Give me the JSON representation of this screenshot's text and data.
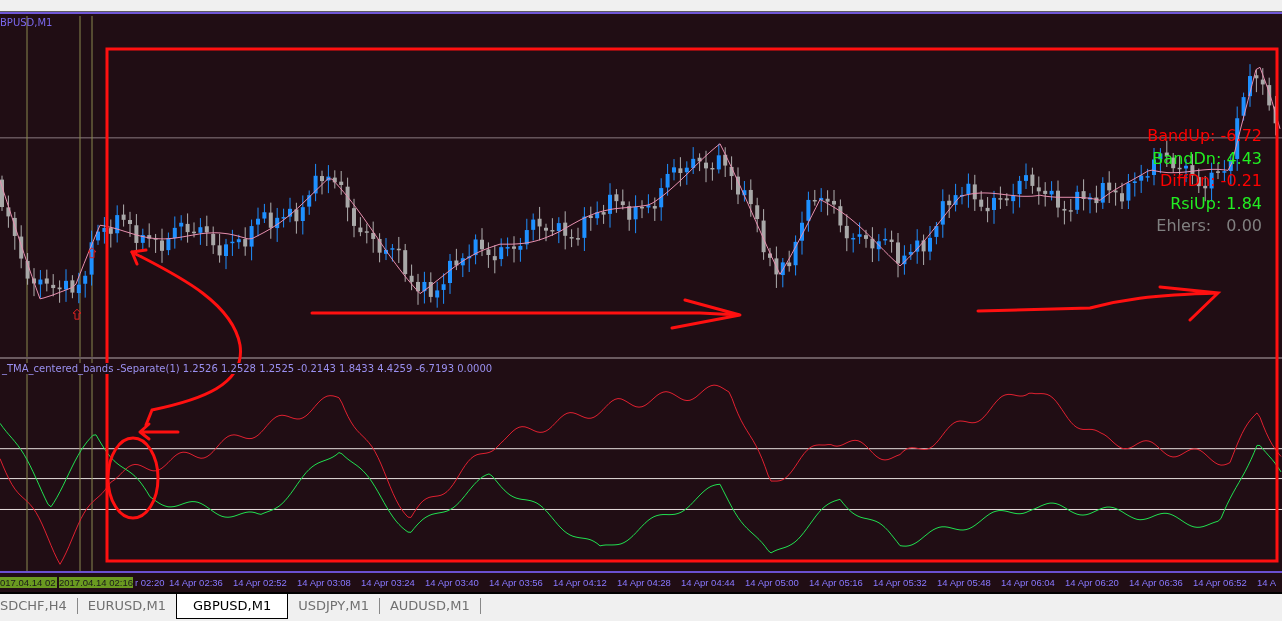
{
  "chart": {
    "title": "BPUSD,M1",
    "readouts": [
      {
        "text": "BandUp: -6.72",
        "color": "#ff0000"
      },
      {
        "text": "BandDn: 4.43",
        "color": "#22ee22"
      },
      {
        "text": "DiffDn: -0.21",
        "color": "#ff0000"
      },
      {
        "text": "RsiUp: 1.84",
        "color": "#22ee22"
      },
      {
        "text": "Ehlers:   0.00",
        "color": "#808080"
      }
    ],
    "indicator_label": "_TMA_centered_bands -Separate(1) 1.2526 1.2528 1.2525 -0.2143 1.8433 4.4259 -6.7193 0.0000"
  },
  "time_axis": {
    "highlighted": [
      "017.04.14 02",
      "2017.04.14 02:16"
    ],
    "partial": "r 02:20",
    "labels": [
      "14 Apr 02:36",
      "14 Apr 02:52",
      "14 Apr 03:08",
      "14 Apr 03:24",
      "14 Apr 03:40",
      "14 Apr 03:56",
      "14 Apr 04:12",
      "14 Apr 04:28",
      "14 Apr 04:44",
      "14 Apr 05:00",
      "14 Apr 05:16",
      "14 Apr 05:32",
      "14 Apr 05:48",
      "14 Apr 06:04",
      "14 Apr 06:20",
      "14 Apr 06:36",
      "14 Apr 06:52",
      "14 A"
    ]
  },
  "tabs": [
    {
      "label": "SDCHF,H4",
      "selected": false
    },
    {
      "label": "EURUSD,M1",
      "selected": false
    },
    {
      "label": "GBPUSD,M1",
      "selected": true
    },
    {
      "label": "USDJPY,M1",
      "selected": false
    },
    {
      "label": "AUDUSD,M1",
      "selected": false
    }
  ]
}
